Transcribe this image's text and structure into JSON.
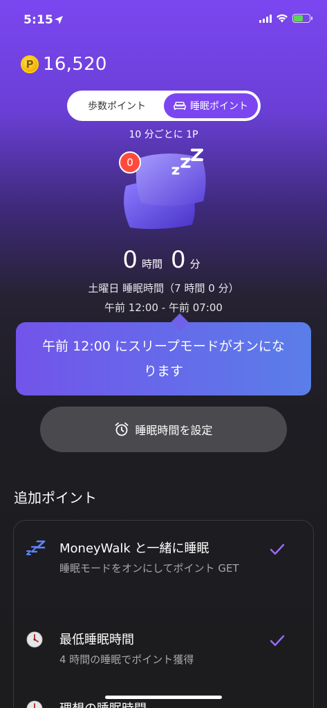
{
  "status_bar": {
    "time": "5:15"
  },
  "header": {
    "points": "16,520",
    "coin_letter": "P"
  },
  "mode_toggle": {
    "options": [
      {
        "label": "歩数ポイント",
        "active": false
      },
      {
        "label": "睡眠ポイント",
        "active": true
      }
    ]
  },
  "rate_text": "10 分ごとに 1P",
  "pillow_badge": "0",
  "sleep_duration": {
    "hours": "0",
    "hours_unit": "時間",
    "minutes": "0",
    "minutes_unit": "分"
  },
  "schedule": {
    "line1": "土曜日 睡眠時間（7 時間 0 分）",
    "line2": "午前 12:00 - 午前 07:00"
  },
  "tooltip": {
    "text": "午前 12:00 にスリープモードがオンになります"
  },
  "set_button": {
    "label": "睡眠時間を設定"
  },
  "additional": {
    "title": "追加ポイント",
    "items": [
      {
        "icon": "zzz-icon",
        "title": "MoneyWalk と一緒に睡眠",
        "desc": "睡眠モードをオンにしてポイント GET",
        "checked": true
      },
      {
        "icon": "clock-icon",
        "title": "最低睡眠時間",
        "desc": "4 時間の睡眠でポイント獲得",
        "checked": true
      },
      {
        "icon": "clock-icon",
        "title": "理想の睡眠時間",
        "desc": "",
        "checked": false
      }
    ]
  },
  "colors": {
    "accent": "#7b46f0",
    "badge": "#ff4b3e",
    "check": "#9b6cff"
  }
}
